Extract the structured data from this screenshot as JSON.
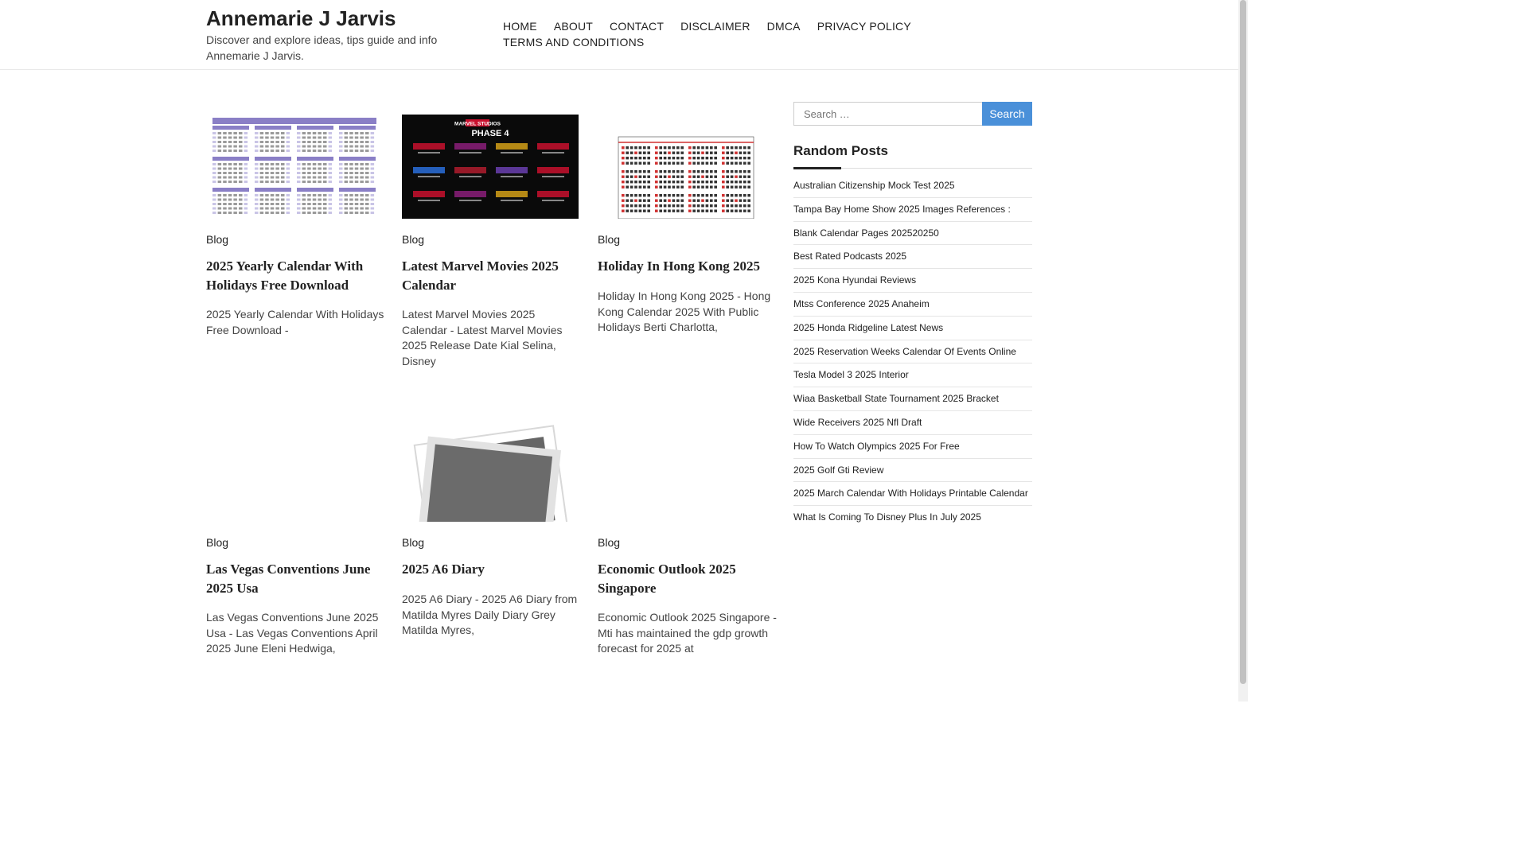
{
  "site": {
    "title": "Annemarie J Jarvis",
    "description": "Discover and explore ideas, tips guide and info Annemarie J Jarvis."
  },
  "nav": [
    "HOME",
    "ABOUT",
    "CONTACT",
    "DISCLAIMER",
    "DMCA",
    "PRIVACY POLICY",
    "TERMS AND CONDITIONS"
  ],
  "posts": [
    {
      "category": "Blog",
      "title": "2025 Yearly Calendar With Holidays Free Download",
      "excerpt": "2025 Yearly Calendar With Holidays Free Download -",
      "image": "calendar-thumbnail"
    },
    {
      "category": "Blog",
      "title": "Latest Marvel Movies 2025 Calendar",
      "excerpt": "Latest Marvel Movies 2025 Calendar - Latest Marvel Movies 2025 Release Date Kial Selina, Disney",
      "image": "marvel-thumbnail",
      "image_text": {
        "brand": "MARVEL STUDIOS",
        "phase": "PHASE 4"
      }
    },
    {
      "category": "Blog",
      "title": "Holiday In Hong Kong 2025",
      "excerpt": "Holiday In Hong Kong 2025 - Hong Kong Calendar 2025 With Public Holidays Berti Charlotta,",
      "image": "hk-calendar-thumbnail"
    },
    {
      "category": "Blog",
      "title": "Las Vegas Conventions June 2025 Usa",
      "excerpt": "Las Vegas Conventions June 2025 Usa - Las Vegas Conventions April 2025 June Eleni Hedwiga,",
      "image": "none"
    },
    {
      "category": "Blog",
      "title": "2025 A6 Diary",
      "excerpt": "2025 A6 Diary - 2025 A6 Diary from Matilda Myres Daily Diary Grey Matilda Myres,",
      "image": "photo-placeholder"
    },
    {
      "category": "Blog",
      "title": "Economic Outlook 2025 Singapore",
      "excerpt": "Economic Outlook 2025 Singapore - Mti has maintained the gdp growth forecast for 2025 at",
      "image": "none"
    }
  ],
  "search": {
    "placeholder": "Search …",
    "button": "Search"
  },
  "random_posts": {
    "title": "Random Posts",
    "items": [
      "Australian Citizenship Mock Test 2025",
      "Tampa Bay Home Show 2025 Images References :",
      "Blank Calendar Pages 202520250",
      "Best Rated Podcasts 2025",
      "2025 Kona Hyundai Reviews",
      "Mtss Conference 2025 Anaheim",
      "2025 Honda Ridgeline Latest News",
      "2025 Reservation Weeks Calendar Of Events Online",
      "Tesla Model 3 2025 Interior",
      "Wiaa Basketball State Tournament 2025 Bracket",
      "Wide Receivers 2025 Nfl Draft",
      "How To Watch Olympics 2025 For Free",
      "2025 Golf Gti Review",
      "2025 March Calendar With Holidays Printable Calendar",
      "What Is Coming To Disney Plus In July 2025"
    ]
  },
  "colors": {
    "accent": "#4a90d9",
    "text": "#222222",
    "calendar_purple": "#8a7fc6",
    "hk_red": "#d03030"
  }
}
